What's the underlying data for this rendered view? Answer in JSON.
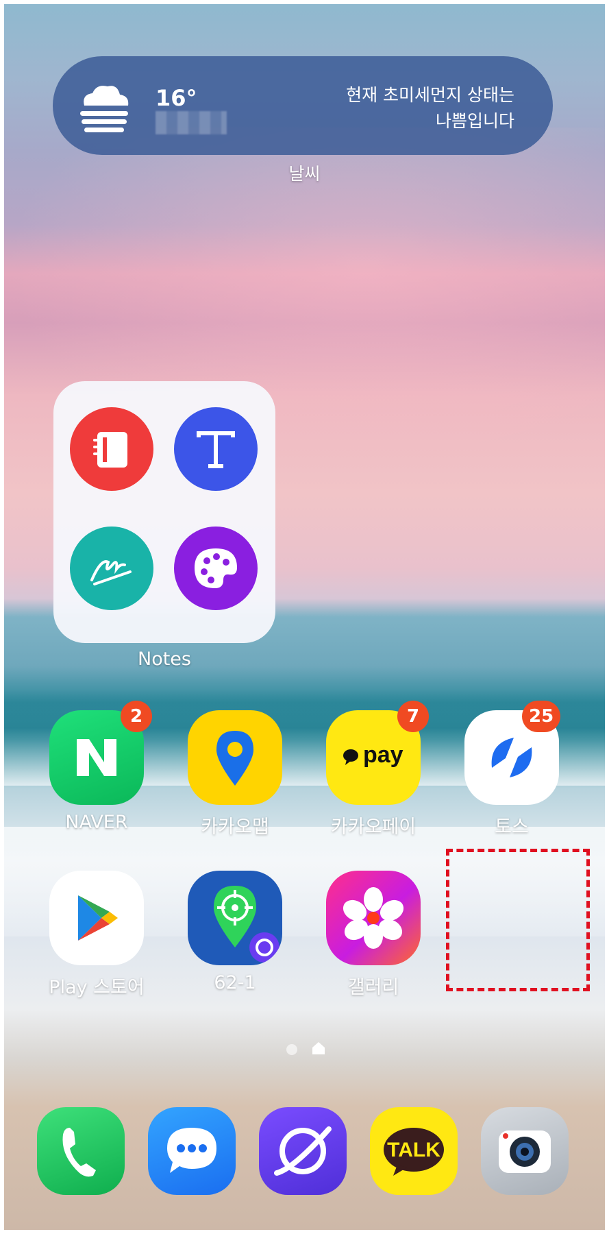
{
  "weather_widget": {
    "temperature": "16°",
    "message_line1": "현재 초미세먼지 상태는",
    "message_line2": "나쁨입니다",
    "caption": "날씨",
    "icon": "cloud-fog-icon"
  },
  "folder": {
    "label": "Notes",
    "apps": [
      {
        "icon": "notebook-icon",
        "color": "#ef3b3b"
      },
      {
        "icon": "text-t-icon",
        "color": "#3c55e8"
      },
      {
        "icon": "signature-icon",
        "color": "#19b3a8"
      },
      {
        "icon": "palette-icon",
        "color": "#8a1fe0"
      }
    ]
  },
  "row1": [
    {
      "label": "NAVER",
      "badge": "2",
      "icon": "naver-n-icon"
    },
    {
      "label": "카카오맵",
      "badge": null,
      "icon": "map-pin-icon"
    },
    {
      "label": "카카오페이",
      "badge": "7",
      "icon": "pay-icon"
    },
    {
      "label": "토스",
      "badge": "25",
      "icon": "toss-icon"
    }
  ],
  "row2": [
    {
      "label": "Play 스토어",
      "icon": "play-store-icon"
    },
    {
      "label": "62-1",
      "icon": "location-target-icon"
    },
    {
      "label": "갤러리",
      "icon": "gallery-flower-icon"
    }
  ],
  "dock": [
    {
      "icon": "phone-icon"
    },
    {
      "icon": "messages-icon"
    },
    {
      "icon": "internet-icon"
    },
    {
      "icon": "kakaotalk-icon",
      "text": "TALK"
    },
    {
      "icon": "camera-icon"
    }
  ],
  "colors": {
    "badge": "#f04a22",
    "highlight": "#e01020",
    "widget_bg": "#3c5c96"
  }
}
